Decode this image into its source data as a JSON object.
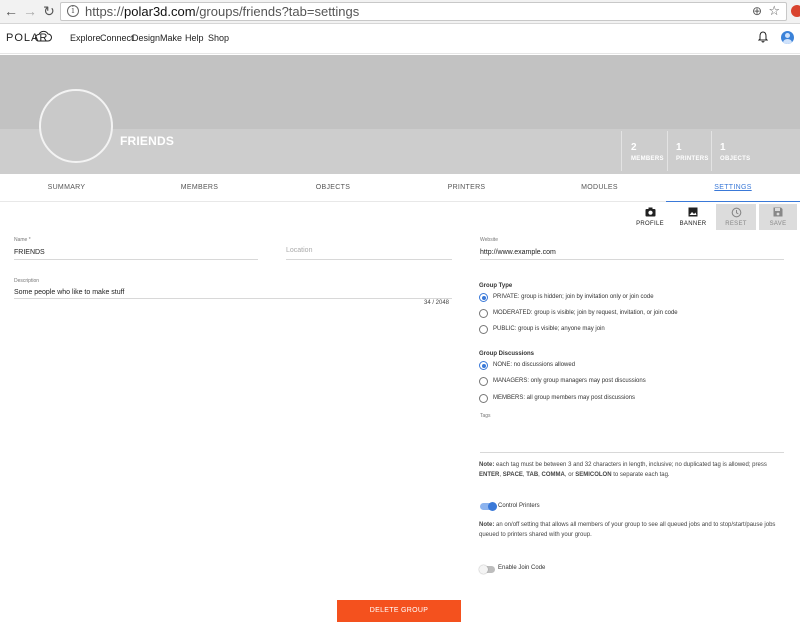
{
  "browser": {
    "url_scheme": "https://",
    "url_host": "polar3d.com",
    "url_path": "/groups/friends?tab=settings",
    "back_glyph": "←",
    "forward_glyph": "→",
    "refresh_glyph": "↻",
    "info_glyph": "i",
    "zoom_glyph": "⊕",
    "star_glyph": "☆",
    "icons": [
      "back-arrow-icon",
      "forward-arrow-icon",
      "refresh-icon",
      "info-icon",
      "zoom-icon",
      "bookmark-star-icon",
      "extension-icon"
    ]
  },
  "header": {
    "logo": "POLAR",
    "nav": [
      "Explore",
      "Connect",
      "Design",
      "Make",
      "Help",
      "Shop"
    ],
    "bell_glyph": "🔔",
    "icons": [
      "cloud-logo-icon",
      "bell-icon",
      "user-avatar-icon"
    ]
  },
  "banner": {
    "group_name": "FRIENDS",
    "stats": [
      {
        "num": "2",
        "label": "MEMBERS"
      },
      {
        "num": "1",
        "label": "PRINTERS"
      },
      {
        "num": "1",
        "label": "OBJECTS"
      }
    ]
  },
  "tabs": [
    "SUMMARY",
    "MEMBERS",
    "OBJECTS",
    "PRINTERS",
    "MODULES",
    "SETTINGS"
  ],
  "active_tab": "SETTINGS",
  "actions": {
    "profile": {
      "label": "PROFILE",
      "icon": "📷",
      "icon_name": "camera-icon"
    },
    "banner": {
      "label": "BANNER",
      "icon": "▣",
      "icon_name": "image-icon"
    },
    "reset": {
      "label": "RESET",
      "icon": "⟲",
      "icon_name": "history-icon"
    },
    "save": {
      "label": "SAVE",
      "icon": "💾",
      "icon_name": "floppy-disk-icon"
    }
  },
  "form": {
    "name_label": "Name *",
    "name_value": "FRIENDS",
    "location_placeholder": "Location",
    "description_label": "Description",
    "description_value": "Some people who like to make stuff",
    "description_counter": "34 / 2048",
    "website_label": "Website",
    "website_value": "http://www.example.com"
  },
  "group_type": {
    "title": "Group Type",
    "options": [
      {
        "label": "PRIVATE: group is hidden; join by invitation only or join code",
        "selected": true
      },
      {
        "label": "MODERATED: group is visible; join by request, invitation, or join code",
        "selected": false
      },
      {
        "label": "PUBLIC: group is visible; anyone may join",
        "selected": false
      }
    ]
  },
  "group_discussions": {
    "title": "Group Discussions",
    "options": [
      {
        "label": "NONE: no discussions allowed",
        "selected": true
      },
      {
        "label": "MANAGERS: only group managers may post discussions",
        "selected": false
      },
      {
        "label": "MEMBERS: all group members may post discussions",
        "selected": false
      }
    ]
  },
  "tags": {
    "label": "Tags",
    "note_prefix": "Note:",
    "note_text1": "each tag must be between 3 and 32 characters in length, inclusive; no duplicated tag is allowed; press",
    "keys": [
      "ENTER",
      "SPACE",
      "TAB",
      "COMMA"
    ],
    "note_or": "or",
    "key_last": "SEMICOLON",
    "note_text2": "to separate each tag."
  },
  "control_printers": {
    "label": "Control Printers",
    "enabled": true,
    "note_prefix": "Note:",
    "note": "an on/off setting that allows all members of your group to see all queued jobs and to stop/start/pause jobs queued to printers shared with your group."
  },
  "join_code": {
    "label": "Enable Join Code",
    "enabled": false
  },
  "delete_label": "DELETE GROUP",
  "colors": {
    "accent": "#3a79d8",
    "danger": "#f4511e",
    "banner": "#c2c2c2"
  }
}
